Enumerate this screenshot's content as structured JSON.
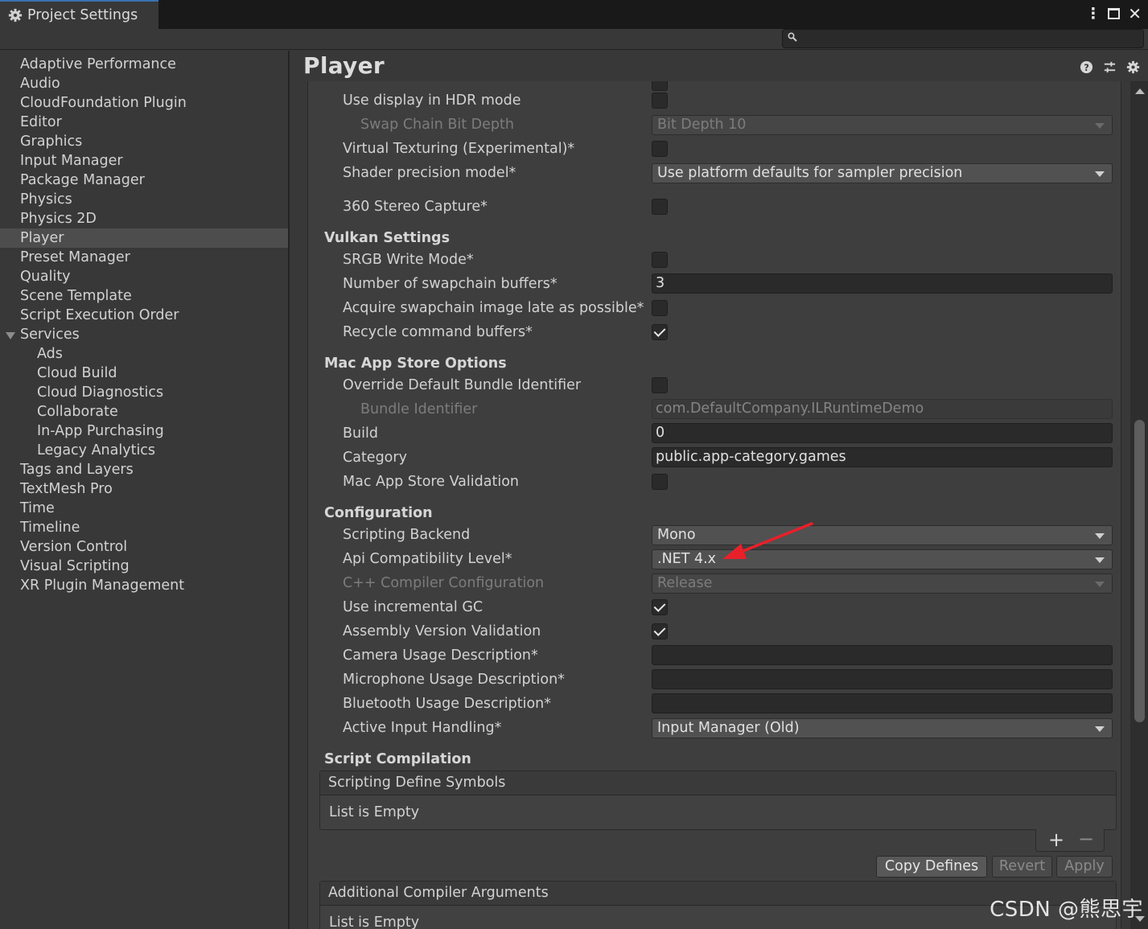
{
  "window": {
    "tab_title": "Project Settings",
    "controls": {
      "menu_icon": "kebab-icon",
      "maximize_icon": "maximize-icon",
      "close_icon": "close-icon"
    }
  },
  "search": {
    "placeholder": "",
    "icon": "search-icon"
  },
  "sidebar": {
    "items": [
      {
        "label": "Adaptive Performance"
      },
      {
        "label": "Audio"
      },
      {
        "label": "CloudFoundation Plugin"
      },
      {
        "label": "Editor"
      },
      {
        "label": "Graphics"
      },
      {
        "label": "Input Manager"
      },
      {
        "label": "Package Manager"
      },
      {
        "label": "Physics"
      },
      {
        "label": "Physics 2D"
      },
      {
        "label": "Player",
        "selected": true
      },
      {
        "label": "Preset Manager"
      },
      {
        "label": "Quality"
      },
      {
        "label": "Scene Template"
      },
      {
        "label": "Script Execution Order"
      },
      {
        "label": "Services",
        "expanded": true
      },
      {
        "label": "Ads",
        "child": true
      },
      {
        "label": "Cloud Build",
        "child": true
      },
      {
        "label": "Cloud Diagnostics",
        "child": true
      },
      {
        "label": "Collaborate",
        "child": true
      },
      {
        "label": "In-App Purchasing",
        "child": true
      },
      {
        "label": "Legacy Analytics",
        "child": true
      },
      {
        "label": "Tags and Layers"
      },
      {
        "label": "TextMesh Pro"
      },
      {
        "label": "Time"
      },
      {
        "label": "Timeline"
      },
      {
        "label": "Version Control"
      },
      {
        "label": "Visual Scripting"
      },
      {
        "label": "XR Plugin Management"
      }
    ]
  },
  "main": {
    "title": "Player",
    "header_icons": [
      "help-icon",
      "preset-icon",
      "settings-gear-icon"
    ],
    "rows": {
      "hdr_mode": {
        "label": "Use display in HDR mode",
        "checked": false
      },
      "swap_chain": {
        "label": "Swap Chain Bit Depth",
        "value": "Bit Depth 10"
      },
      "virtual_texturing": {
        "label": "Virtual Texturing (Experimental)*",
        "checked": false
      },
      "shader_precision": {
        "label": "Shader precision model*",
        "value": "Use platform defaults for sampler precision"
      },
      "stereo_capture": {
        "label": "360 Stereo Capture*",
        "checked": false
      }
    },
    "vulkan": {
      "title": "Vulkan Settings",
      "srgb": {
        "label": "SRGB Write Mode*",
        "checked": false
      },
      "swapchain_buffers": {
        "label": "Number of swapchain buffers*",
        "value": "3"
      },
      "acquire_late": {
        "label": "Acquire swapchain image late as possible*",
        "checked": false
      },
      "recycle": {
        "label": "Recycle command buffers*",
        "checked": true
      }
    },
    "mac": {
      "title": "Mac App Store Options",
      "override_bundle": {
        "label": "Override Default Bundle Identifier",
        "checked": false
      },
      "bundle_id": {
        "label": "Bundle Identifier",
        "value": "com.DefaultCompany.ILRuntimeDemo"
      },
      "build": {
        "label": "Build",
        "value": "0"
      },
      "category": {
        "label": "Category",
        "value": "public.app-category.games"
      },
      "validation": {
        "label": "Mac App Store Validation",
        "checked": false
      }
    },
    "config": {
      "title": "Configuration",
      "backend": {
        "label": "Scripting Backend",
        "value": "Mono"
      },
      "api_level": {
        "label": "Api Compatibility Level*",
        "value": ".NET 4.x"
      },
      "cpp_config": {
        "label": "C++ Compiler Configuration",
        "value": "Release"
      },
      "incremental_gc": {
        "label": "Use incremental GC",
        "checked": true
      },
      "assembly_validation": {
        "label": "Assembly Version Validation",
        "checked": true
      },
      "camera_desc": {
        "label": "Camera Usage Description*",
        "value": ""
      },
      "mic_desc": {
        "label": "Microphone Usage Description*",
        "value": ""
      },
      "bt_desc": {
        "label": "Bluetooth Usage Description*",
        "value": ""
      },
      "input_handling": {
        "label": "Active Input Handling*",
        "value": "Input Manager (Old)"
      }
    },
    "script_compilation": {
      "title": "Script Compilation",
      "define_symbols": {
        "header": "Scripting Define Symbols",
        "empty": "List is Empty"
      },
      "plus": "+",
      "minus": "−",
      "buttons": {
        "copy": "Copy Defines",
        "revert": "Revert",
        "apply": "Apply"
      },
      "compiler_args": {
        "header": "Additional Compiler Arguments",
        "empty": "List is Empty"
      }
    }
  },
  "watermark": "CSDN @熊思宇",
  "colors": {
    "selection": "#4d4d4d",
    "accent_tab": "#3a72b0",
    "annotation_arrow": "#e8202a"
  }
}
